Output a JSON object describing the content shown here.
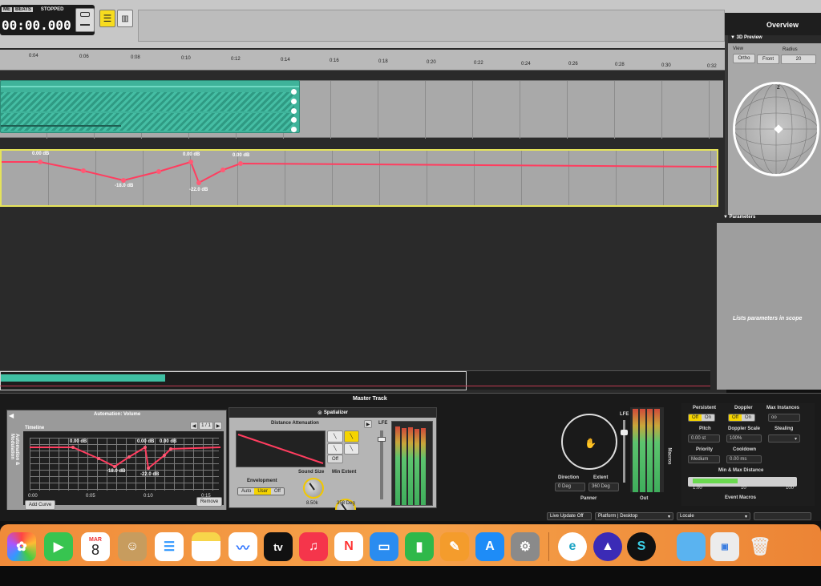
{
  "transport": {
    "mode_time": "ME",
    "mode_beats": "BEATS",
    "state": "STOPPED",
    "time": "00:00.000"
  },
  "ruler": {
    "ticks": [
      "0:04",
      "0:06",
      "0:08",
      "0:10",
      "0:12",
      "0:14",
      "0:16",
      "0:18",
      "0:20",
      "0:22",
      "0:24",
      "0:26",
      "0:28",
      "0:30",
      "0:32"
    ]
  },
  "automation_lane": {
    "labels": [
      "0.00 dB",
      "-18.0 dB",
      "0.00 dB",
      "-22.0 dB",
      "0.00 dB"
    ]
  },
  "right_panel": {
    "overview": "Overview",
    "preview_3d": "3D Preview",
    "view_label": "View",
    "radius_label": "Radius",
    "ortho": "Ortho",
    "front": "Front",
    "radius_value": "20",
    "z_axis": "Z",
    "parameters": "Parameters",
    "parameters_hint": "Lists parameters in scope"
  },
  "master": {
    "title": "Master Track",
    "automation_title": "Automation: Volume",
    "page": "1 / 1",
    "timeline": "Timeline",
    "side_label": "Automation & Modulation",
    "curve_labels": [
      "0.00 dB",
      "0.00 dB",
      "0.00 dB",
      "-18.0 dB",
      "-22.0 dB"
    ],
    "curve_ticks": [
      "0:00",
      "0:05",
      "0:10",
      "0:15"
    ],
    "add_curve": "Add Curve",
    "remove": "Remove",
    "spatializer": "Spatializer",
    "distance_attenuation": "Distance Attenuation",
    "off": "Off",
    "envelopment": "Envelopment",
    "env_auto": "Auto",
    "env_user": "User",
    "env_off": "Off",
    "sound_size": "Sound Size",
    "sound_size_value": "8.50k",
    "min_extent": "Min Extent",
    "min_extent_value": "358 Deg",
    "lfe": "LFE",
    "panner": "Panner",
    "out": "Out",
    "direction": "Direction",
    "direction_value": "0 Deg",
    "extent": "Extent",
    "extent_value": "360 Deg",
    "lfe2": "LFE",
    "macros": "Macros",
    "persistent": "Persistent",
    "doppler": "Doppler",
    "max_instances": "Max Instances",
    "off1": "Off",
    "on1": "On",
    "off2": "Off",
    "on2": "On",
    "max_instances_value": "oo",
    "pitch": "Pitch",
    "pitch_value": "0.00 st",
    "doppler_scale": "Doppler Scale",
    "doppler_scale_value": "100%",
    "stealing": "Stealing",
    "priority": "Priority",
    "priority_value": "Medium",
    "cooldown": "Cooldown",
    "cooldown_value": "0.00 ms",
    "min_max_distance": "Min & Max Distance",
    "distance_ticks": [
      "1.00",
      "10",
      "100"
    ],
    "event_macros": "Event Macros"
  },
  "status_bar": {
    "live_update": "Live Update Off",
    "platform_label": "Platform",
    "platform_value": "Desktop",
    "locale_label": "Locale"
  },
  "dock": {
    "calendar_month": "MAR",
    "calendar_day": "8",
    "tv_label": "tv",
    "icons": [
      "photos-icon",
      "facetime-icon",
      "calendar-icon",
      "contacts-icon",
      "reminders-icon",
      "notes-icon",
      "freeform-icon",
      "apple-tv-icon",
      "music-icon",
      "news-icon",
      "keynote-icon",
      "numbers-icon",
      "pages-icon",
      "app-store-icon",
      "system-settings-icon",
      "edge-icon",
      "arc-icon",
      "fmod-icon",
      "folder-icon",
      "preview-icon",
      "trash-icon"
    ]
  }
}
